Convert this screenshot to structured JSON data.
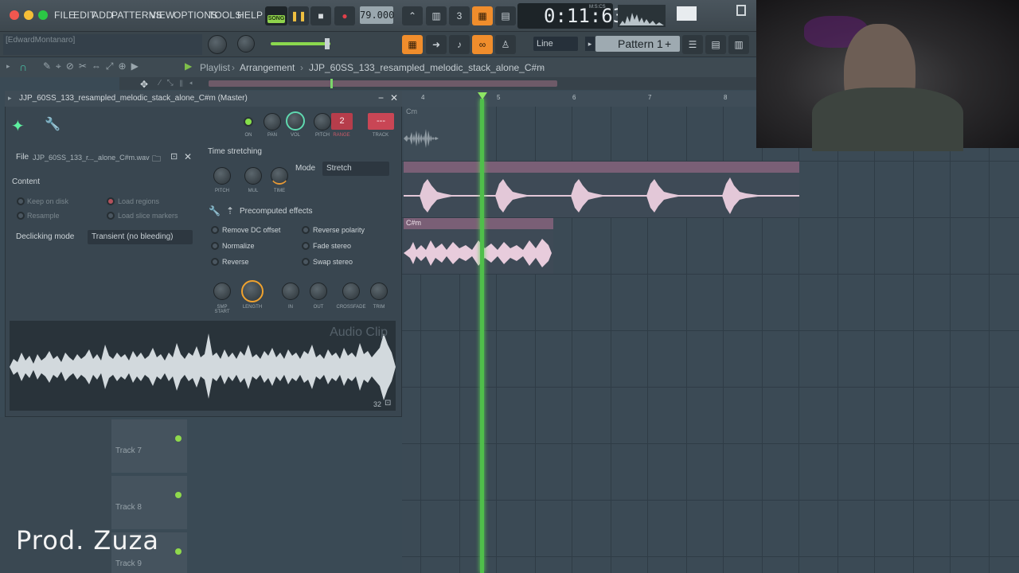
{
  "menu": [
    "FILE",
    "EDIT",
    "ADD",
    "PATTERNS",
    "VIEW",
    "OPTIONS",
    "TOOLS",
    "HELP"
  ],
  "transport": {
    "mode_label": "SONG",
    "tempo": "79.000",
    "time": "0:11:63",
    "time_units": "M:S:CS"
  },
  "hint_bar": {
    "text": "[EdwardMontanaro]"
  },
  "toolbar2": {
    "snap": "Line",
    "pattern": "Pattern 1"
  },
  "playlist": {
    "title": "Playlist",
    "breadcrumb_sep": "›",
    "section": "Arrangement",
    "clip_path": "JJP_60SS_133_resampled_melodic_stack_alone_C#m",
    "ruler": [
      "4",
      "5",
      "6",
      "7",
      "8"
    ],
    "clips": [
      {
        "label": "Cm"
      },
      {
        "label": ""
      },
      {
        "label": "C#m"
      }
    ],
    "tracks": [
      "Track 7",
      "Track 8",
      "Track 9"
    ]
  },
  "channel_window": {
    "title": "JJP_60SS_133_resampled_melodic_stack_alone_C#m (Master)",
    "knobs": [
      {
        "label": "ON"
      },
      {
        "label": "PAN"
      },
      {
        "label": "VOL"
      },
      {
        "label": "PITCH"
      },
      {
        "label": "RANGE"
      },
      {
        "label": "TRACK"
      }
    ],
    "range_value": "2",
    "track_value": "---",
    "file_label": "File",
    "file_name": "JJP_60SS_133_r..._alone_C#m.wav",
    "content_label": "Content",
    "keep_on_disk": "Keep on disk",
    "resample": "Resample",
    "load_regions": "Load regions",
    "load_slice_markers": "Load slice markers",
    "declicking_label": "Declicking mode",
    "declicking_value": "Transient (no bleeding)",
    "time_stretching": "Time stretching",
    "ts_knobs": [
      "PITCH",
      "MUL",
      "TIME"
    ],
    "mode_label": "Mode",
    "mode_value": "Stretch",
    "precomputed": "Precomputed effects",
    "effects": [
      {
        "label": "Remove DC offset"
      },
      {
        "label": "Reverse polarity"
      },
      {
        "label": "Normalize"
      },
      {
        "label": "Fade stereo"
      },
      {
        "label": "Reverse"
      },
      {
        "label": "Swap stereo"
      }
    ],
    "bottom_knobs": [
      "SMP START",
      "LENGTH",
      "IN",
      "OUT",
      "CROSSFADE",
      "TRIM"
    ],
    "audio_clip_label": "Audio Clip",
    "wave_num": "32"
  },
  "overlay": {
    "producer": "Prod. Zuza"
  }
}
